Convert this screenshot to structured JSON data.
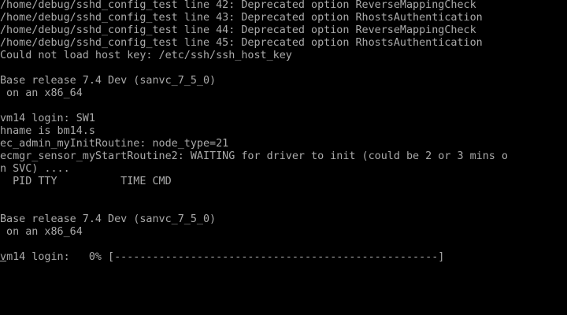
{
  "console": {
    "lines": [
      "/home/debug/sshd_config_test line 42: Deprecated option ReverseMappingCheck",
      "/home/debug/sshd_config_test line 43: Deprecated option RhostsAuthentication",
      "/home/debug/sshd_config_test line 44: Deprecated option ReverseMappingCheck",
      "/home/debug/sshd_config_test line 45: Deprecated option RhostsAuthentication",
      "Could not load host key: /etc/ssh/ssh_host_key",
      "",
      "Base release 7.4 Dev (sanvc_7_5_0)",
      " on an x86_64",
      "",
      "vm14 login: SW1",
      "hname is bm14.s",
      "ec_admin_myInitRoutine: node_type=21",
      "ecmgr_sensor_myStartRoutine2: WAITING for driver to init (could be 2 or 3 mins o",
      "n SVC) ....",
      "  PID TTY          TIME CMD",
      "",
      "",
      "Base release 7.4 Dev (sanvc_7_5_0)",
      " on an x86_64",
      ""
    ],
    "prompt": {
      "cursor_char": "v",
      "rest": "m14 login:   0% [---------------------------------------------------]"
    },
    "colors": {
      "background": "#000000",
      "foreground": "#aaaaaa"
    }
  }
}
